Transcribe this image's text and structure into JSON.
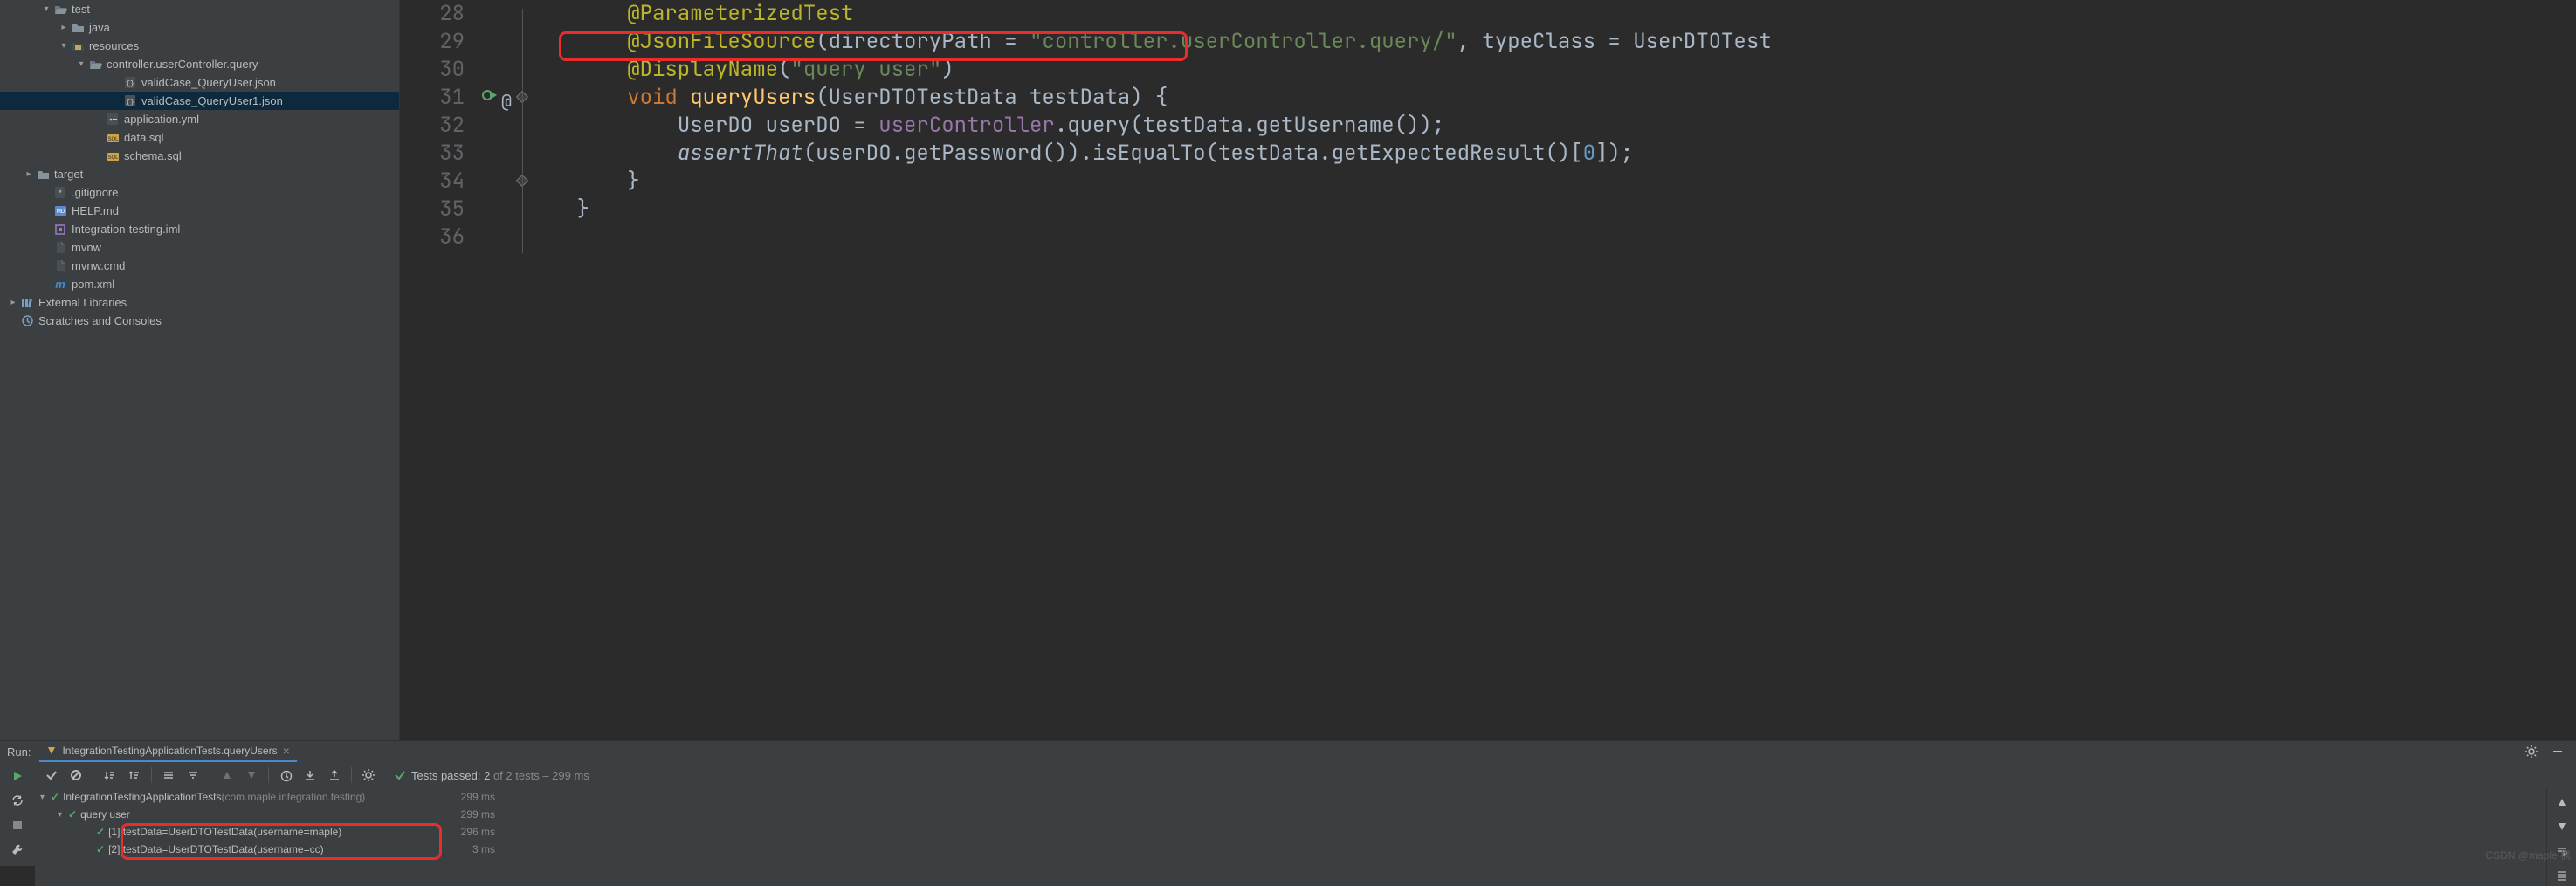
{
  "sidebar": {
    "items": [
      {
        "indent": 46,
        "chev": "down",
        "icon": "folder-open",
        "label": "test"
      },
      {
        "indent": 66,
        "chev": "right",
        "icon": "folder",
        "label": "java"
      },
      {
        "indent": 66,
        "chev": "down",
        "icon": "resources",
        "label": "resources"
      },
      {
        "indent": 86,
        "chev": "down",
        "icon": "folder-open",
        "label": "controller.userController.query"
      },
      {
        "indent": 126,
        "chev": "",
        "icon": "json",
        "label": "validCase_QueryUser.json"
      },
      {
        "indent": 126,
        "chev": "",
        "icon": "json",
        "label": "validCase_QueryUser1.json",
        "selected": true
      },
      {
        "indent": 106,
        "chev": "",
        "icon": "yml",
        "label": "application.yml"
      },
      {
        "indent": 106,
        "chev": "",
        "icon": "sql",
        "label": "data.sql"
      },
      {
        "indent": 106,
        "chev": "",
        "icon": "sql",
        "label": "schema.sql"
      },
      {
        "indent": 26,
        "chev": "right",
        "icon": "folder",
        "label": "target"
      },
      {
        "indent": 46,
        "chev": "",
        "icon": "git",
        "label": ".gitignore"
      },
      {
        "indent": 46,
        "chev": "",
        "icon": "md",
        "label": "HELP.md"
      },
      {
        "indent": 46,
        "chev": "",
        "icon": "iml",
        "label": "Integration-testing.iml"
      },
      {
        "indent": 46,
        "chev": "",
        "icon": "file",
        "label": "mvnw"
      },
      {
        "indent": 46,
        "chev": "",
        "icon": "file",
        "label": "mvnw.cmd"
      },
      {
        "indent": 46,
        "chev": "",
        "icon": "maven",
        "label": "pom.xml"
      },
      {
        "indent": 8,
        "chev": "right",
        "icon": "lib",
        "label": "External Libraries"
      },
      {
        "indent": 8,
        "chev": "",
        "icon": "scratch",
        "label": "Scratches and Consoles"
      }
    ]
  },
  "editor": {
    "lines": [
      {
        "n": 28,
        "segments": [
          {
            "t": "        ",
            "c": ""
          },
          {
            "t": "@ParameterizedTest",
            "c": "ann"
          }
        ]
      },
      {
        "n": 29,
        "segments": [
          {
            "t": "        ",
            "c": ""
          },
          {
            "t": "@JsonFileSource",
            "c": "ann"
          },
          {
            "t": "(",
            "c": "ident"
          },
          {
            "t": "directoryPath = ",
            "c": "ident"
          },
          {
            "t": "\"controller.userController.query/\"",
            "c": "str"
          },
          {
            "t": ",",
            "c": "ident"
          },
          {
            "t": " typeClass = UserDTOTest",
            "c": "ident"
          }
        ]
      },
      {
        "n": 30,
        "segments": [
          {
            "t": "        ",
            "c": ""
          },
          {
            "t": "@DisplayName",
            "c": "ann"
          },
          {
            "t": "(",
            "c": "ident"
          },
          {
            "t": "\"query user\"",
            "c": "str"
          },
          {
            "t": ")",
            "c": "ident"
          }
        ]
      },
      {
        "n": 31,
        "segments": [
          {
            "t": "        ",
            "c": ""
          },
          {
            "t": "void ",
            "c": "kw"
          },
          {
            "t": "queryUsers",
            "c": "fn"
          },
          {
            "t": "(UserDTOTestData testData) {",
            "c": "ident"
          }
        ]
      },
      {
        "n": 32,
        "segments": [
          {
            "t": "            ",
            "c": ""
          },
          {
            "t": "UserDO userDO = ",
            "c": "ident"
          },
          {
            "t": "userController",
            "c": "mcall"
          },
          {
            "t": ".query(testData.getUsername());",
            "c": "ident"
          }
        ]
      },
      {
        "n": 33,
        "segments": [
          {
            "t": "            ",
            "c": ""
          },
          {
            "t": "assertThat",
            "c": "ident it"
          },
          {
            "t": "(userDO.getPassword()).isEqualTo(testData.getExpectedResult()[",
            "c": "ident"
          },
          {
            "t": "0",
            "c": "num"
          },
          {
            "t": "]);",
            "c": "ident"
          }
        ]
      },
      {
        "n": 34,
        "segments": [
          {
            "t": "        }",
            "c": "ident"
          }
        ]
      },
      {
        "n": 35,
        "segments": [
          {
            "t": "    }",
            "c": "ident"
          }
        ]
      },
      {
        "n": 36,
        "segments": [
          {
            "t": "",
            "c": ""
          }
        ]
      }
    ]
  },
  "run": {
    "label": "Run:",
    "tab": "IntegrationTestingApplicationTests.queryUsers",
    "tests_passed_prefix": "Tests passed: ",
    "tests_passed_count": "2",
    "tests_passed_rest": " of 2 tests – 299 ms",
    "tree": [
      {
        "indent": 6,
        "chev": "down",
        "check": true,
        "label": "IntegrationTestingApplicationTests",
        "extra": "(com.maple.integration.testing)",
        "ms": "299 ms"
      },
      {
        "indent": 26,
        "chev": "down",
        "check": true,
        "label": "query user",
        "extra": "",
        "ms": "299 ms"
      },
      {
        "indent": 58,
        "chev": "",
        "check": true,
        "label": "[1] testData=UserDTOTestData(username=maple)",
        "extra": "",
        "ms": "296 ms"
      },
      {
        "indent": 58,
        "chev": "",
        "check": true,
        "label": "[2] testData=UserDTOTestData(username=cc)",
        "extra": "",
        "ms": "3 ms"
      }
    ]
  },
  "watermark": "CSDN @maple 枫"
}
